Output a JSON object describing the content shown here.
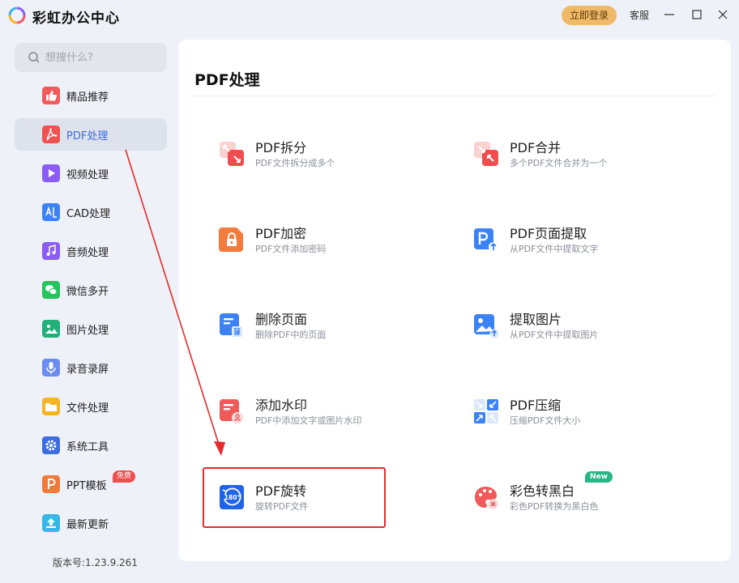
{
  "app": {
    "title": "彩虹办公中心"
  },
  "titlebar": {
    "login_label": "立即登录",
    "service_label": "客服"
  },
  "search": {
    "placeholder": "想搜什么?"
  },
  "sidebar": {
    "items": [
      {
        "label": "精品推荐",
        "icon": "thumbs-up-icon",
        "color": "#f05a5a"
      },
      {
        "label": "PDF处理",
        "icon": "pdf-icon",
        "color": "#f05252",
        "active": true
      },
      {
        "label": "视频处理",
        "icon": "video-play-icon",
        "color": "#8b5cf6"
      },
      {
        "label": "CAD处理",
        "icon": "cad-icon",
        "color": "#3b82f6"
      },
      {
        "label": "音频处理",
        "icon": "music-note-icon",
        "color": "#8b5cf6"
      },
      {
        "label": "微信多开",
        "icon": "wechat-icon",
        "color": "#22c55e"
      },
      {
        "label": "图片处理",
        "icon": "image-icon",
        "color": "#22b07a"
      },
      {
        "label": "录音录屏",
        "icon": "microphone-icon",
        "color": "#6b8cf0"
      },
      {
        "label": "文件处理",
        "icon": "folder-icon",
        "color": "#f6b325"
      },
      {
        "label": "系统工具",
        "icon": "gear-icon",
        "color": "#3b6ce0"
      },
      {
        "label": "PPT模板",
        "icon": "ppt-icon",
        "color": "#f07a3a",
        "badge": "免费"
      },
      {
        "label": "最新更新",
        "icon": "upload-icon",
        "color": "#38b6e8"
      }
    ],
    "version": "版本号:1.23.9.261"
  },
  "main": {
    "title": "PDF处理",
    "tools": [
      {
        "name": "PDF拆分",
        "desc": "PDF文件拆分成多个",
        "icon": "split-arrows-icon"
      },
      {
        "name": "PDF合并",
        "desc": "多个PDF文件合并为一个",
        "icon": "merge-arrows-icon"
      },
      {
        "name": "PDF加密",
        "desc": "PDF文件添加密码",
        "icon": "lock-icon"
      },
      {
        "name": "PDF页面提取",
        "desc": "从PDF文件中提取文字",
        "icon": "page-extract-icon"
      },
      {
        "name": "删除页面",
        "desc": "删除PDF中的页面",
        "icon": "delete-page-icon"
      },
      {
        "name": "提取图片",
        "desc": "从PDF文件中提取图片",
        "icon": "extract-image-icon"
      },
      {
        "name": "添加水印",
        "desc": "PDF中添加文字或图片水印",
        "icon": "watermark-icon"
      },
      {
        "name": "PDF压缩",
        "desc": "压缩PDF文件大小",
        "icon": "compress-icon"
      },
      {
        "name": "PDF旋转",
        "desc": "旋转PDF文件",
        "icon": "rotate-180-icon",
        "highlighted": true
      },
      {
        "name": "彩色转黑白",
        "desc": "彩色PDF转换为黑白色",
        "icon": "color-to-bw-icon",
        "badge": "New"
      }
    ]
  },
  "colors": {
    "accent": "#3b6ce0",
    "highlight": "#e52b2b",
    "login": "#f0b968"
  }
}
